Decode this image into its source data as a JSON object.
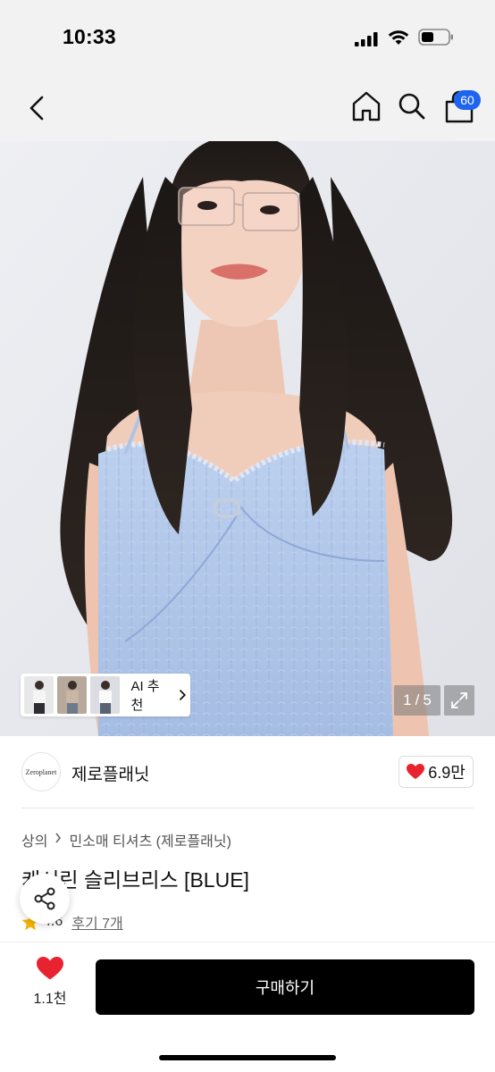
{
  "status_bar": {
    "time": "10:33"
  },
  "nav": {
    "cart_badge": "60"
  },
  "gallery": {
    "ai_label": "AI 추천",
    "current": "1",
    "separator": "/",
    "total": "5"
  },
  "brand": {
    "logo_text": "Zeroplanet",
    "name": "제로플래닛",
    "likes": "6.9만"
  },
  "breadcrumb": {
    "category": "상의",
    "subcategory": "민소매 티셔츠 (제로플래닛)"
  },
  "product": {
    "title": "캐서린 슬리브리스 [BLUE]",
    "rating": "4.6",
    "reviews": "후기 7개"
  },
  "bottom_bar": {
    "wish_count": "1.1천",
    "buy_label": "구매하기"
  },
  "colors": {
    "accent_blue": "#1d64f0",
    "heart_red": "#e8222e",
    "star_yellow": "#f5b300",
    "buy_button": "#000000"
  }
}
